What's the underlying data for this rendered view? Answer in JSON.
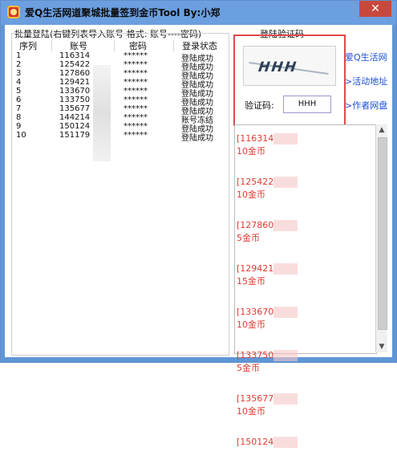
{
  "window": {
    "title": "爱Q生活网道聚城批量签到金币Tool  By:小郑",
    "close_label": "✕"
  },
  "left_group": {
    "title": "批量登陆(右键列表导入账号 格式: 账号----密码)"
  },
  "table": {
    "headers": [
      "序列",
      "账号",
      "密码",
      "登录状态"
    ],
    "rows": [
      {
        "index": "1",
        "account": "116314",
        "password": "******",
        "status": "登陆成功"
      },
      {
        "index": "2",
        "account": "125422",
        "password": "******",
        "status": "登陆成功"
      },
      {
        "index": "3",
        "account": "127860",
        "password": "******",
        "status": "登陆成功"
      },
      {
        "index": "4",
        "account": "129421",
        "password": "******",
        "status": "登陆成功"
      },
      {
        "index": "5",
        "account": "133670",
        "password": "******",
        "status": "登陆成功"
      },
      {
        "index": "6",
        "account": "133750",
        "password": "******",
        "status": "登陆成功"
      },
      {
        "index": "7",
        "account": "135677",
        "password": "******",
        "status": "登陆成功"
      },
      {
        "index": "8",
        "account": "144214",
        "password": "******",
        "status": "账号冻结"
      },
      {
        "index": "9",
        "account": "150124",
        "password": "******",
        "status": "登陆成功"
      },
      {
        "index": "10",
        "account": "151179",
        "password": "******",
        "status": "登陆成功"
      }
    ]
  },
  "vcode": {
    "group_title": "登陆验证码",
    "captcha_text": "HHH",
    "label": "验证码:",
    "input_value": "HHH"
  },
  "links": [
    {
      "label": "爱Q生活网"
    },
    {
      "label": ">活动地址"
    },
    {
      "label": ">作者网盘"
    }
  ],
  "log": [
    {
      "line1": "[116314",
      "line2": "10金币"
    },
    {
      "line1": "[125422",
      "line2": "10金币"
    },
    {
      "line1": "[127860",
      "line2": "5金币"
    },
    {
      "line1": "[129421",
      "line2": "15金币"
    },
    {
      "line1": "[133670",
      "line2": "10金币"
    },
    {
      "line1": "[133750",
      "line2": "5金币"
    },
    {
      "line1": "[135677",
      "line2": "10金币"
    },
    {
      "line1": "[150124",
      "line2": ""
    }
  ],
  "scrollbar": {
    "up": "▲",
    "down": "▼"
  },
  "colors": {
    "log_text": "#e33a33",
    "link": "#1a4fd4",
    "highlight_border": "#e04a4a"
  }
}
